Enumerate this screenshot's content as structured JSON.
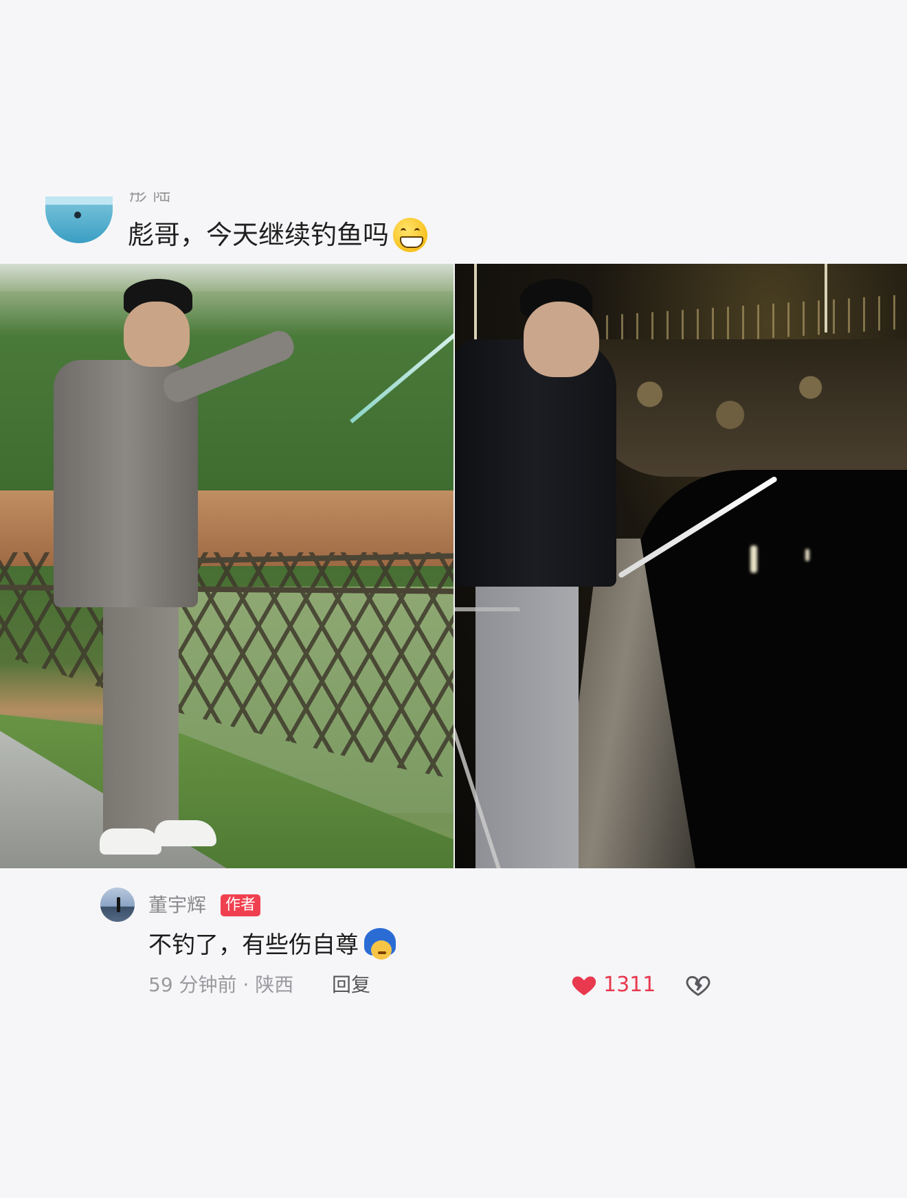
{
  "top_comment": {
    "username": "彤 陆",
    "text": "彪哥，今天继续钓鱼吗",
    "emoji": "grinning-face-emoji"
  },
  "photos": {
    "left": "daytime-fishing-photo",
    "right": "night-fishing-photo"
  },
  "author_reply": {
    "name": "董宇辉",
    "badge": "作者",
    "text": "不钓了，有些伤自尊",
    "emoji": "blue-hair-face-emoji",
    "time_location": "59 分钟前 · 陕西",
    "reply_label": "回复",
    "likes": "1311"
  },
  "colors": {
    "background": "#f6f6f8",
    "badge": "#f0404f",
    "like": "#e8394e"
  }
}
